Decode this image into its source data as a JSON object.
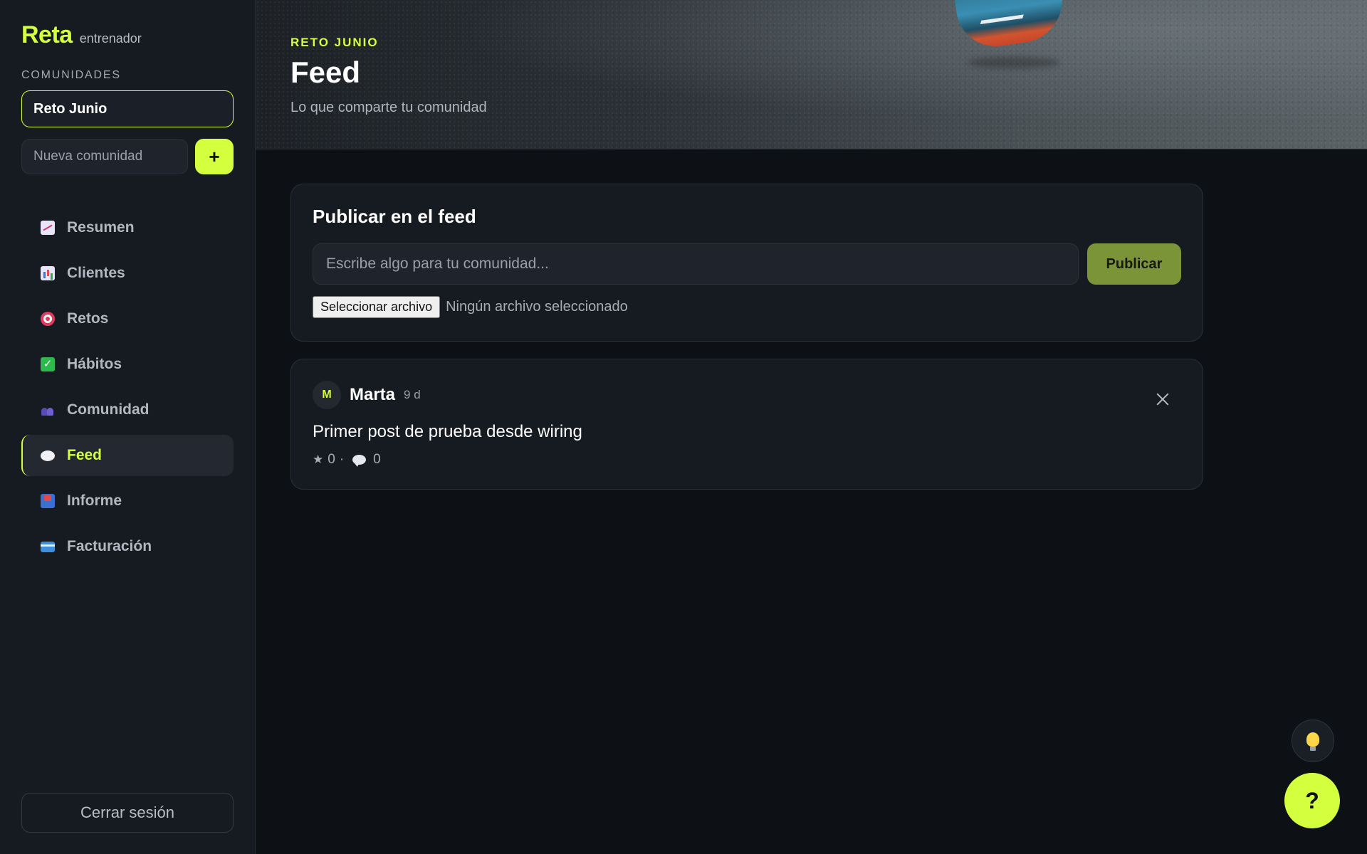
{
  "brand": {
    "name": "Reta",
    "role": "entrenador"
  },
  "sidebar": {
    "section_label": "COMUNIDADES",
    "selected_community": "Reto Junio",
    "new_community_placeholder": "Nueva comunidad",
    "add_button_label": "+",
    "nav": [
      {
        "label": "Resumen",
        "icon": "chart-up-icon"
      },
      {
        "label": "Clientes",
        "icon": "bar-chart-icon"
      },
      {
        "label": "Retos",
        "icon": "target-icon"
      },
      {
        "label": "Hábitos",
        "icon": "checkbox-icon"
      },
      {
        "label": "Comunidad",
        "icon": "people-icon"
      },
      {
        "label": "Feed",
        "icon": "speech-bubble-icon",
        "active": true
      },
      {
        "label": "Informe",
        "icon": "inbox-tray-icon"
      },
      {
        "label": "Facturación",
        "icon": "credit-card-icon"
      }
    ],
    "logout_label": "Cerrar sesión"
  },
  "header": {
    "eyebrow": "RETO JUNIO",
    "title": "Feed",
    "subtitle": "Lo que comparte tu comunidad"
  },
  "composer": {
    "title": "Publicar en el feed",
    "placeholder": "Escribe algo para tu comunidad...",
    "publish_label": "Publicar",
    "file_button_label": "Seleccionar archivo",
    "file_status": "Ningún archivo seleccionado"
  },
  "posts": [
    {
      "avatar_initial": "M",
      "author": "Marta",
      "time": "9 d",
      "text": "Primer post de prueba desde wiring",
      "stars_icon": "★",
      "stars": "0",
      "separator": "·",
      "comments": "0"
    }
  ],
  "floating": {
    "tips_icon": "lightbulb-icon",
    "help_label": "?"
  },
  "colors": {
    "accent": "#d4ff3f",
    "background": "#0d1014",
    "sidebar": "#161a21",
    "publish_button": "#7b9438"
  }
}
